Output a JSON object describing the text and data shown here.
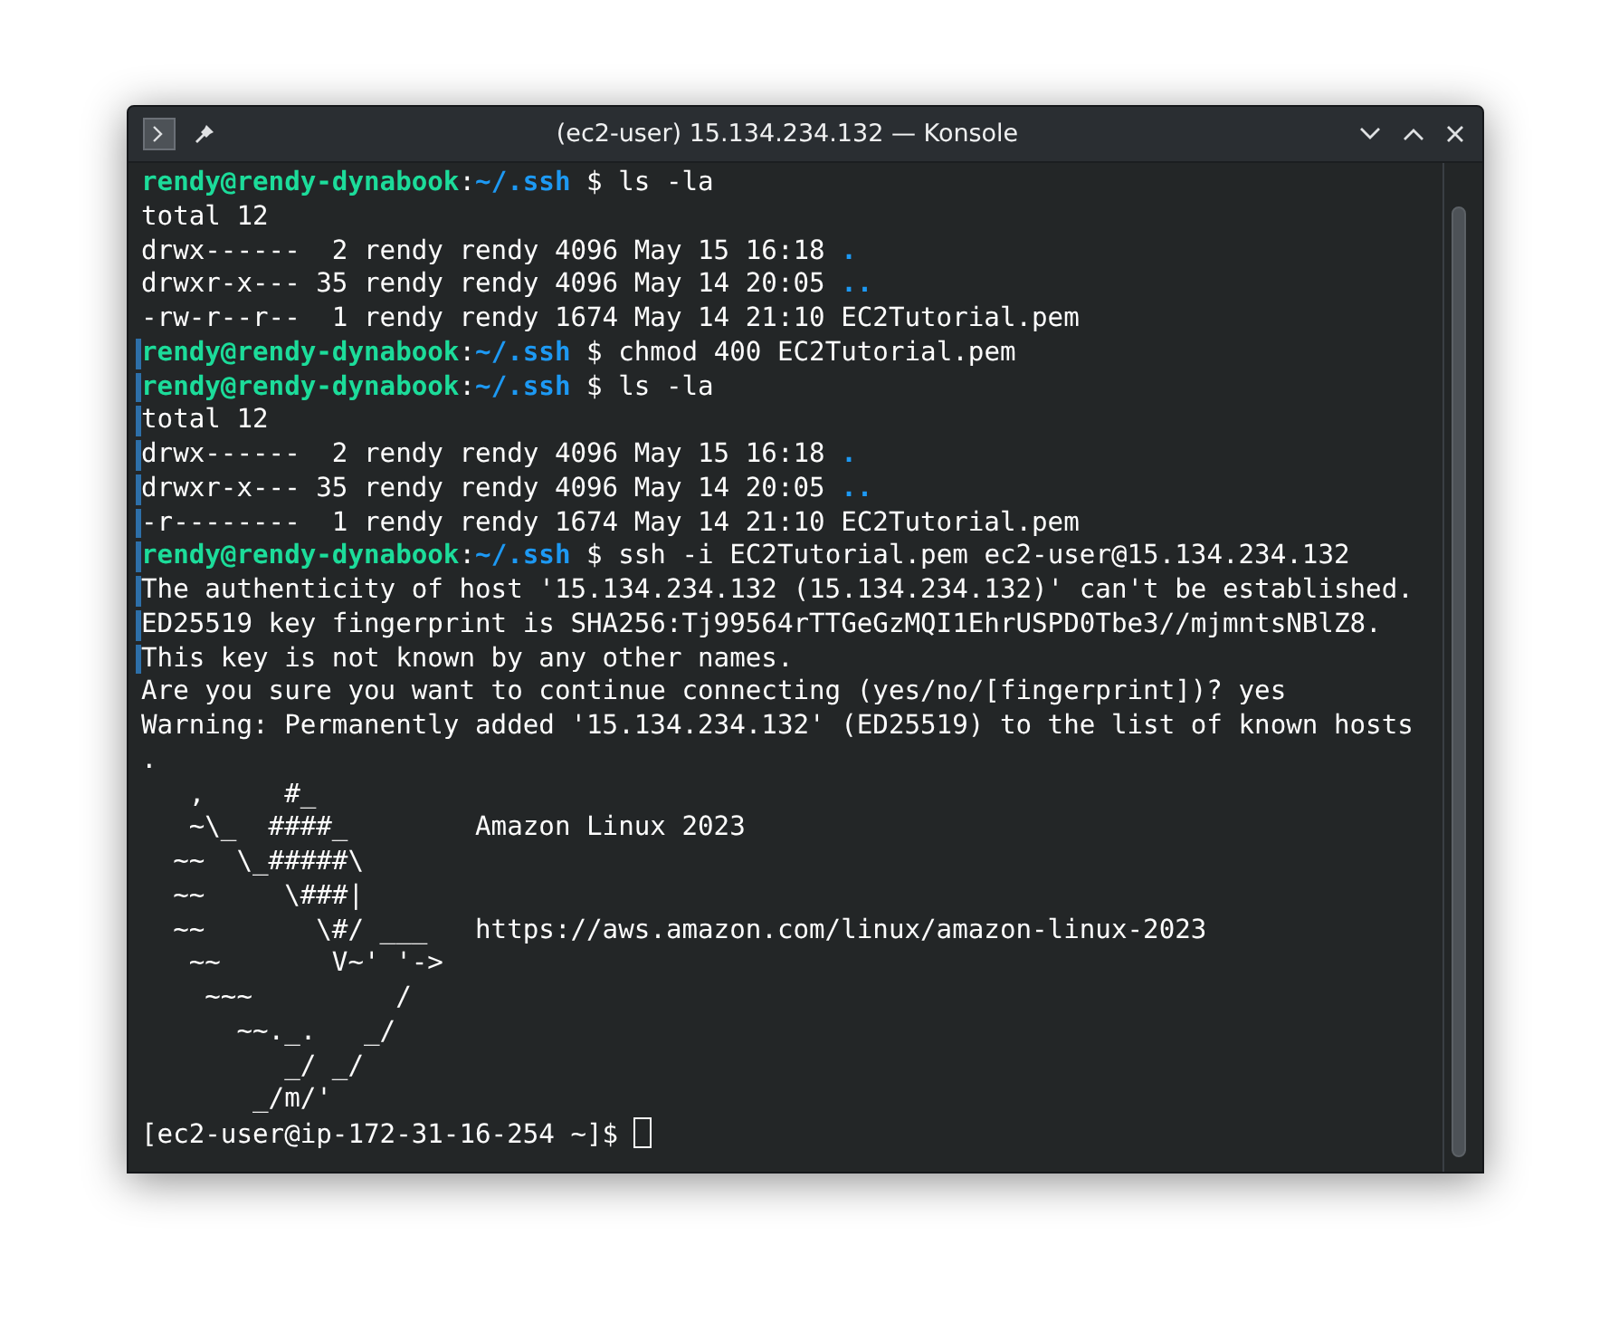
{
  "window": {
    "title": "(ec2-user) 15.134.234.132 — Konsole"
  },
  "terminal": {
    "cursor": true,
    "lines": [
      {
        "marked": false,
        "segments": [
          {
            "kind": "user",
            "text": "rendy@rendy-dynabook"
          },
          {
            "kind": "plain",
            "text": ":"
          },
          {
            "kind": "path",
            "text": "~/.ssh"
          },
          {
            "kind": "plain",
            "text": " $ ls -la"
          }
        ]
      },
      {
        "marked": false,
        "segments": [
          {
            "kind": "plain",
            "text": "total 12"
          }
        ]
      },
      {
        "marked": false,
        "segments": [
          {
            "kind": "plain",
            "text": "drwx------  2 rendy rendy 4096 May 15 16:18 "
          },
          {
            "kind": "dir",
            "text": "."
          }
        ]
      },
      {
        "marked": false,
        "segments": [
          {
            "kind": "plain",
            "text": "drwxr-x--- 35 rendy rendy 4096 May 14 20:05 "
          },
          {
            "kind": "dir",
            "text": ".."
          }
        ]
      },
      {
        "marked": false,
        "segments": [
          {
            "kind": "plain",
            "text": "-rw-r--r--  1 rendy rendy 1674 May 14 21:10 EC2Tutorial.pem"
          }
        ]
      },
      {
        "marked": true,
        "segments": [
          {
            "kind": "user",
            "text": "rendy@rendy-dynabook"
          },
          {
            "kind": "plain",
            "text": ":"
          },
          {
            "kind": "path",
            "text": "~/.ssh"
          },
          {
            "kind": "plain",
            "text": " $ chmod 400 EC2Tutorial.pem"
          }
        ]
      },
      {
        "marked": true,
        "segments": [
          {
            "kind": "user",
            "text": "rendy@rendy-dynabook"
          },
          {
            "kind": "plain",
            "text": ":"
          },
          {
            "kind": "path",
            "text": "~/.ssh"
          },
          {
            "kind": "plain",
            "text": " $ ls -la"
          }
        ]
      },
      {
        "marked": true,
        "segments": [
          {
            "kind": "plain",
            "text": "total 12"
          }
        ]
      },
      {
        "marked": true,
        "segments": [
          {
            "kind": "plain",
            "text": "drwx------  2 rendy rendy 4096 May 15 16:18 "
          },
          {
            "kind": "dir",
            "text": "."
          }
        ]
      },
      {
        "marked": true,
        "segments": [
          {
            "kind": "plain",
            "text": "drwxr-x--- 35 rendy rendy 4096 May 14 20:05 "
          },
          {
            "kind": "dir",
            "text": ".."
          }
        ]
      },
      {
        "marked": true,
        "segments": [
          {
            "kind": "plain",
            "text": "-r--------  1 rendy rendy 1674 May 14 21:10 EC2Tutorial.pem"
          }
        ]
      },
      {
        "marked": true,
        "segments": [
          {
            "kind": "user",
            "text": "rendy@rendy-dynabook"
          },
          {
            "kind": "plain",
            "text": ":"
          },
          {
            "kind": "path",
            "text": "~/.ssh"
          },
          {
            "kind": "plain",
            "text": " $ ssh -i EC2Tutorial.pem ec2-user@15.134.234.132"
          }
        ]
      },
      {
        "marked": true,
        "segments": [
          {
            "kind": "plain",
            "text": "The authenticity of host '15.134.234.132 (15.134.234.132)' can't be established."
          }
        ]
      },
      {
        "marked": true,
        "segments": [
          {
            "kind": "plain",
            "text": "ED25519 key fingerprint is SHA256:Tj99564rTTGeGzMQI1EhrUSPD0Tbe3//mjmntsNBlZ8."
          }
        ]
      },
      {
        "marked": true,
        "segments": [
          {
            "kind": "plain",
            "text": "This key is not known by any other names."
          }
        ]
      },
      {
        "marked": false,
        "segments": [
          {
            "kind": "plain",
            "text": "Are you sure you want to continue connecting (yes/no/[fingerprint])? yes"
          }
        ]
      },
      {
        "marked": false,
        "segments": [
          {
            "kind": "plain",
            "text": "Warning: Permanently added '15.134.234.132' (ED25519) to the list of known hosts"
          }
        ]
      },
      {
        "marked": false,
        "segments": [
          {
            "kind": "plain",
            "text": "."
          }
        ]
      },
      {
        "marked": false,
        "segments": [
          {
            "kind": "plain",
            "text": "   ,     #_"
          }
        ]
      },
      {
        "marked": false,
        "segments": [
          {
            "kind": "plain",
            "text": "   ~\\_  ####_        Amazon Linux 2023"
          }
        ]
      },
      {
        "marked": false,
        "segments": [
          {
            "kind": "plain",
            "text": "  ~~  \\_#####\\"
          }
        ]
      },
      {
        "marked": false,
        "segments": [
          {
            "kind": "plain",
            "text": "  ~~     \\###|"
          }
        ]
      },
      {
        "marked": false,
        "segments": [
          {
            "kind": "plain",
            "text": "  ~~       \\#/ ___   https://aws.amazon.com/linux/amazon-linux-2023"
          }
        ]
      },
      {
        "marked": false,
        "segments": [
          {
            "kind": "plain",
            "text": "   ~~       V~' '->"
          }
        ]
      },
      {
        "marked": false,
        "segments": [
          {
            "kind": "plain",
            "text": "    ~~~         /"
          }
        ]
      },
      {
        "marked": false,
        "segments": [
          {
            "kind": "plain",
            "text": "      ~~._.   _/"
          }
        ]
      },
      {
        "marked": false,
        "segments": [
          {
            "kind": "plain",
            "text": "         _/ _/"
          }
        ]
      },
      {
        "marked": false,
        "segments": [
          {
            "kind": "plain",
            "text": "       _/m/'"
          }
        ]
      },
      {
        "marked": false,
        "segments": [
          {
            "kind": "plain",
            "text": "[ec2-user@ip-172-31-16-254 ~]$ "
          }
        ]
      }
    ]
  }
}
